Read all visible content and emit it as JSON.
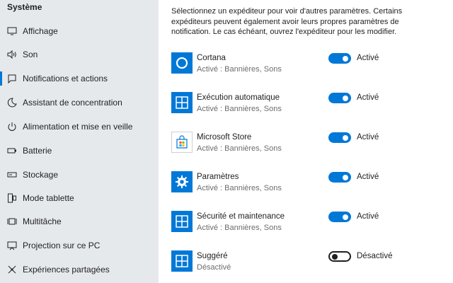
{
  "sidebar": {
    "header": "Système",
    "items": [
      {
        "label": "Affichage",
        "icon": "display-icon"
      },
      {
        "label": "Son",
        "icon": "speaker-icon"
      },
      {
        "label": "Notifications et actions",
        "icon": "notification-icon"
      },
      {
        "label": "Assistant de concentration",
        "icon": "moon-icon"
      },
      {
        "label": "Alimentation et mise en veille",
        "icon": "power-icon"
      },
      {
        "label": "Batterie",
        "icon": "battery-icon"
      },
      {
        "label": "Stockage",
        "icon": "storage-icon"
      },
      {
        "label": "Mode tablette",
        "icon": "tablet-icon"
      },
      {
        "label": "Multitâche",
        "icon": "multitask-icon"
      },
      {
        "label": "Projection sur ce PC",
        "icon": "projection-icon"
      },
      {
        "label": "Expériences partagées",
        "icon": "shared-experiences-icon"
      }
    ],
    "selected_index": 2
  },
  "main": {
    "intro": "Sélectionnez un expéditeur pour voir d'autres paramètres. Certains expéditeurs peuvent également avoir leurs propres paramètres de notification. Le cas échéant, ouvrez l'expéditeur pour les modifier.",
    "apps": [
      {
        "name": "Cortana",
        "status": "Activé : Bannières, Sons",
        "toggle_label": "Activé",
        "on": true,
        "icon": "cortana-icon"
      },
      {
        "name": "Exécution automatique",
        "status": "Activé : Bannières, Sons",
        "toggle_label": "Activé",
        "on": true,
        "icon": "app-tile-icon"
      },
      {
        "name": "Microsoft Store",
        "status": "Activé : Bannières, Sons",
        "toggle_label": "Activé",
        "on": true,
        "icon": "store-icon"
      },
      {
        "name": "Paramètres",
        "status": "Activé : Bannières, Sons",
        "toggle_label": "Activé",
        "on": true,
        "icon": "gear-icon"
      },
      {
        "name": "Sécurité et maintenance",
        "status": "Activé : Bannières, Sons",
        "toggle_label": "Activé",
        "on": true,
        "icon": "app-tile-icon"
      },
      {
        "name": "Suggéré",
        "status": "Désactivé",
        "toggle_label": "Désactivé",
        "on": false,
        "icon": "app-tile-icon"
      }
    ]
  },
  "colors": {
    "accent": "#0078d7",
    "sidebar_bg": "#e6e9ec",
    "secondary_text": "#6d6d6d"
  }
}
